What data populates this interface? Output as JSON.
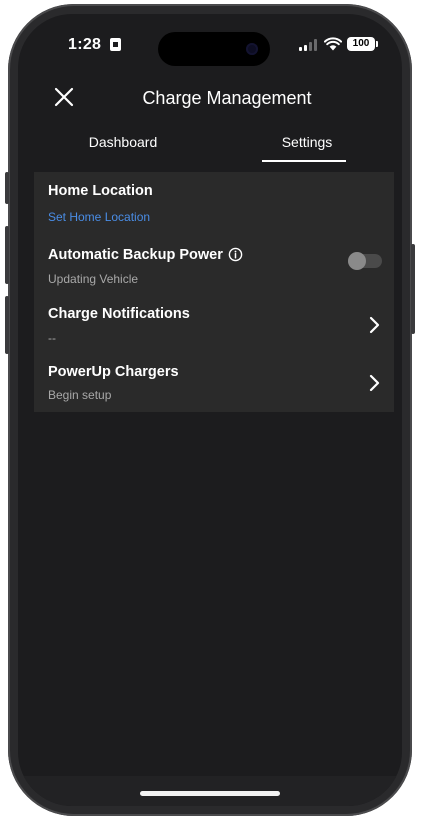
{
  "status_bar": {
    "time": "1:28",
    "battery": "100"
  },
  "header": {
    "title": "Charge Management"
  },
  "tabs": [
    {
      "label": "Dashboard",
      "active": false
    },
    {
      "label": "Settings",
      "active": true
    }
  ],
  "settings": {
    "home_location": {
      "title": "Home Location",
      "subtitle": "Set Home Location"
    },
    "backup_power": {
      "title": "Automatic Backup Power",
      "subtitle": "Updating Vehicle",
      "toggle_on": false
    },
    "charge_notifications": {
      "title": "Charge Notifications",
      "subtitle": "--"
    },
    "powerup_chargers": {
      "title": "PowerUp Chargers",
      "subtitle": "Begin setup"
    }
  },
  "colors": {
    "background": "#1c1c1e",
    "card": "#2a2a2a",
    "link": "#4a8de6",
    "text": "#ffffff",
    "subtext": "#a8a8a8"
  }
}
